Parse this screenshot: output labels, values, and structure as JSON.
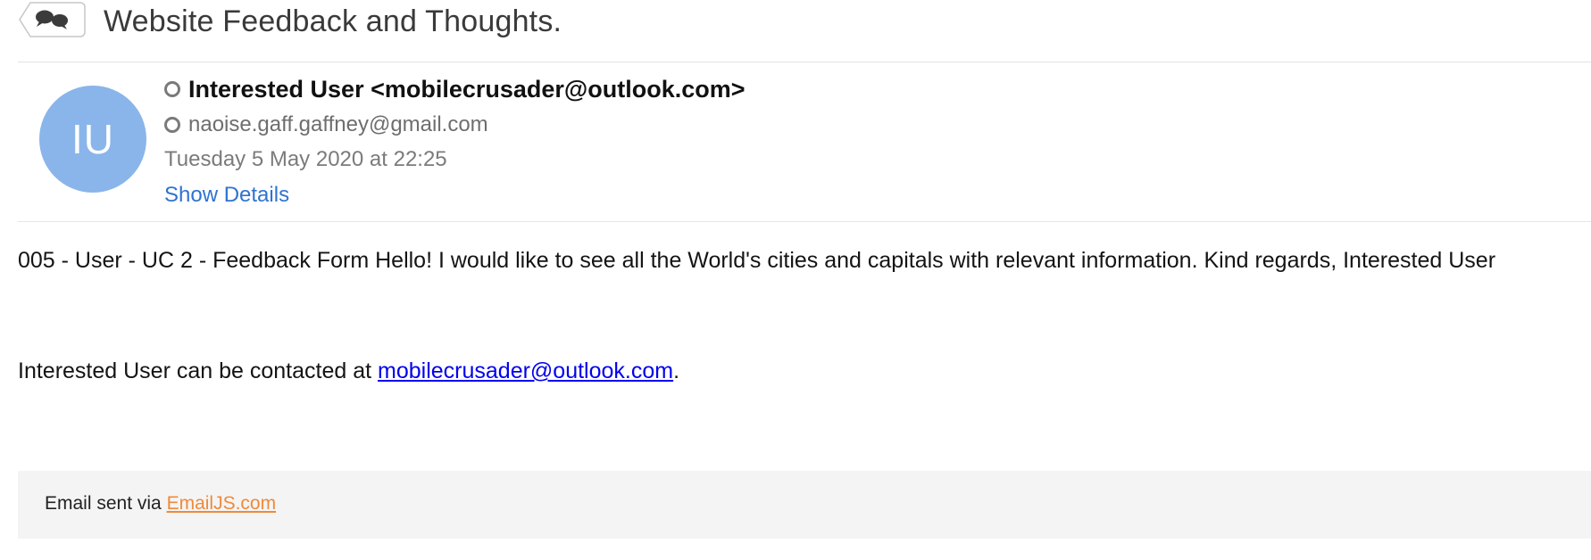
{
  "email": {
    "subject": "Website Feedback and Thoughts.",
    "thread_icon": "conversation-bubbles-icon",
    "sender": {
      "avatar_initials": "IU",
      "avatar_color": "#8ab5ea",
      "from": "Interested User <mobilecrusader@outlook.com>",
      "to": "naoise.gaff.gaffney@gmail.com",
      "date": "Tuesday 5 May 2020 at 22:25",
      "show_details_label": "Show Details",
      "status_icon": "presence-circle-icon"
    },
    "body": {
      "message": "005 - User - UC 2 - Feedback Form Hello! I would like to see all the World's cities and capitals with relevant information. Kind regards, Interested User",
      "contact_prefix": "Interested User can be contacted at ",
      "contact_email": "mobilecrusader@outlook.com",
      "contact_suffix": "."
    },
    "footer": {
      "prefix": "Email sent via ",
      "link_label": "EmailJS.com",
      "link_color": "#ef8a3a"
    }
  },
  "colors": {
    "link_blue": "#2f73d0",
    "hyperlink": "#0000ee",
    "footer_bg": "#f4f4f4"
  }
}
